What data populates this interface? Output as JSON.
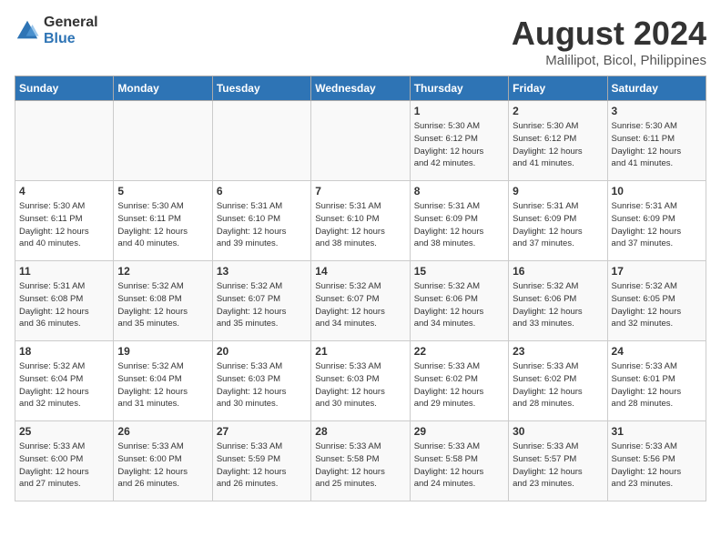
{
  "header": {
    "logo": {
      "general": "General",
      "blue": "Blue"
    },
    "title": "August 2024",
    "subtitle": "Malilipot, Bicol, Philippines"
  },
  "calendar": {
    "days_of_week": [
      "Sunday",
      "Monday",
      "Tuesday",
      "Wednesday",
      "Thursday",
      "Friday",
      "Saturday"
    ],
    "weeks": [
      [
        {
          "day": "",
          "info": ""
        },
        {
          "day": "",
          "info": ""
        },
        {
          "day": "",
          "info": ""
        },
        {
          "day": "",
          "info": ""
        },
        {
          "day": "1",
          "info": "Sunrise: 5:30 AM\nSunset: 6:12 PM\nDaylight: 12 hours\nand 42 minutes."
        },
        {
          "day": "2",
          "info": "Sunrise: 5:30 AM\nSunset: 6:12 PM\nDaylight: 12 hours\nand 41 minutes."
        },
        {
          "day": "3",
          "info": "Sunrise: 5:30 AM\nSunset: 6:11 PM\nDaylight: 12 hours\nand 41 minutes."
        }
      ],
      [
        {
          "day": "4",
          "info": "Sunrise: 5:30 AM\nSunset: 6:11 PM\nDaylight: 12 hours\nand 40 minutes."
        },
        {
          "day": "5",
          "info": "Sunrise: 5:30 AM\nSunset: 6:11 PM\nDaylight: 12 hours\nand 40 minutes."
        },
        {
          "day": "6",
          "info": "Sunrise: 5:31 AM\nSunset: 6:10 PM\nDaylight: 12 hours\nand 39 minutes."
        },
        {
          "day": "7",
          "info": "Sunrise: 5:31 AM\nSunset: 6:10 PM\nDaylight: 12 hours\nand 38 minutes."
        },
        {
          "day": "8",
          "info": "Sunrise: 5:31 AM\nSunset: 6:09 PM\nDaylight: 12 hours\nand 38 minutes."
        },
        {
          "day": "9",
          "info": "Sunrise: 5:31 AM\nSunset: 6:09 PM\nDaylight: 12 hours\nand 37 minutes."
        },
        {
          "day": "10",
          "info": "Sunrise: 5:31 AM\nSunset: 6:09 PM\nDaylight: 12 hours\nand 37 minutes."
        }
      ],
      [
        {
          "day": "11",
          "info": "Sunrise: 5:31 AM\nSunset: 6:08 PM\nDaylight: 12 hours\nand 36 minutes."
        },
        {
          "day": "12",
          "info": "Sunrise: 5:32 AM\nSunset: 6:08 PM\nDaylight: 12 hours\nand 35 minutes."
        },
        {
          "day": "13",
          "info": "Sunrise: 5:32 AM\nSunset: 6:07 PM\nDaylight: 12 hours\nand 35 minutes."
        },
        {
          "day": "14",
          "info": "Sunrise: 5:32 AM\nSunset: 6:07 PM\nDaylight: 12 hours\nand 34 minutes."
        },
        {
          "day": "15",
          "info": "Sunrise: 5:32 AM\nSunset: 6:06 PM\nDaylight: 12 hours\nand 34 minutes."
        },
        {
          "day": "16",
          "info": "Sunrise: 5:32 AM\nSunset: 6:06 PM\nDaylight: 12 hours\nand 33 minutes."
        },
        {
          "day": "17",
          "info": "Sunrise: 5:32 AM\nSunset: 6:05 PM\nDaylight: 12 hours\nand 32 minutes."
        }
      ],
      [
        {
          "day": "18",
          "info": "Sunrise: 5:32 AM\nSunset: 6:04 PM\nDaylight: 12 hours\nand 32 minutes."
        },
        {
          "day": "19",
          "info": "Sunrise: 5:32 AM\nSunset: 6:04 PM\nDaylight: 12 hours\nand 31 minutes."
        },
        {
          "day": "20",
          "info": "Sunrise: 5:33 AM\nSunset: 6:03 PM\nDaylight: 12 hours\nand 30 minutes."
        },
        {
          "day": "21",
          "info": "Sunrise: 5:33 AM\nSunset: 6:03 PM\nDaylight: 12 hours\nand 30 minutes."
        },
        {
          "day": "22",
          "info": "Sunrise: 5:33 AM\nSunset: 6:02 PM\nDaylight: 12 hours\nand 29 minutes."
        },
        {
          "day": "23",
          "info": "Sunrise: 5:33 AM\nSunset: 6:02 PM\nDaylight: 12 hours\nand 28 minutes."
        },
        {
          "day": "24",
          "info": "Sunrise: 5:33 AM\nSunset: 6:01 PM\nDaylight: 12 hours\nand 28 minutes."
        }
      ],
      [
        {
          "day": "25",
          "info": "Sunrise: 5:33 AM\nSunset: 6:00 PM\nDaylight: 12 hours\nand 27 minutes."
        },
        {
          "day": "26",
          "info": "Sunrise: 5:33 AM\nSunset: 6:00 PM\nDaylight: 12 hours\nand 26 minutes."
        },
        {
          "day": "27",
          "info": "Sunrise: 5:33 AM\nSunset: 5:59 PM\nDaylight: 12 hours\nand 26 minutes."
        },
        {
          "day": "28",
          "info": "Sunrise: 5:33 AM\nSunset: 5:58 PM\nDaylight: 12 hours\nand 25 minutes."
        },
        {
          "day": "29",
          "info": "Sunrise: 5:33 AM\nSunset: 5:58 PM\nDaylight: 12 hours\nand 24 minutes."
        },
        {
          "day": "30",
          "info": "Sunrise: 5:33 AM\nSunset: 5:57 PM\nDaylight: 12 hours\nand 23 minutes."
        },
        {
          "day": "31",
          "info": "Sunrise: 5:33 AM\nSunset: 5:56 PM\nDaylight: 12 hours\nand 23 minutes."
        }
      ]
    ]
  }
}
